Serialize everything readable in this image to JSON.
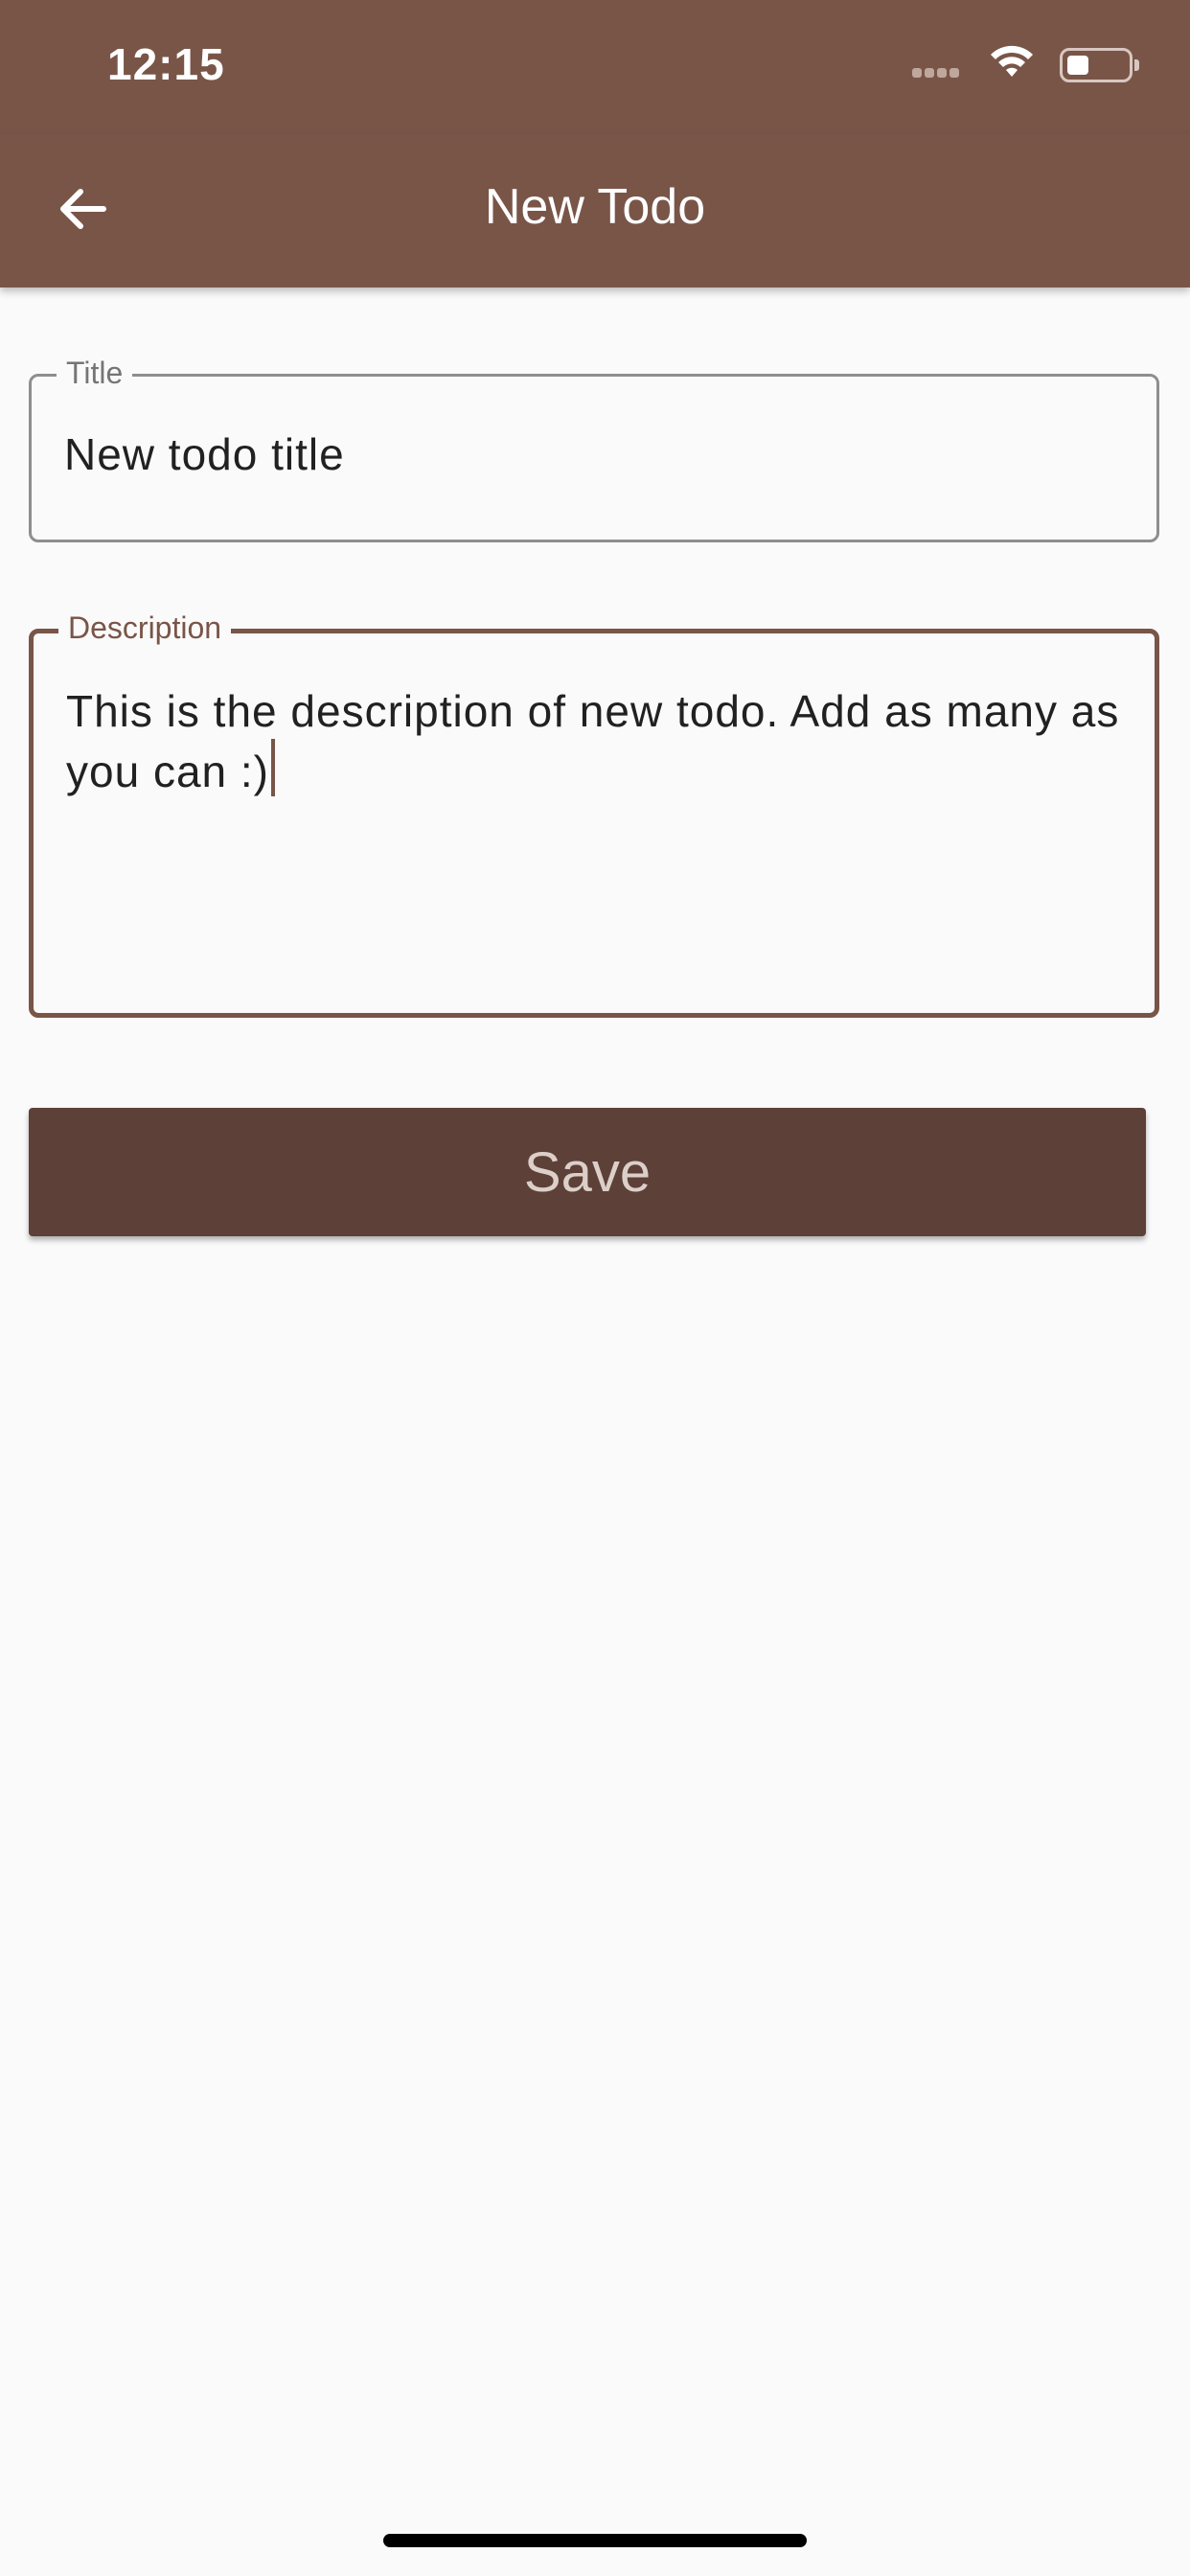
{
  "status_bar": {
    "time": "12:15",
    "icons": [
      "signal-icon",
      "wifi-icon",
      "battery-icon"
    ]
  },
  "app_bar": {
    "title": "New Todo",
    "back_icon": "arrow-left-icon",
    "color": "#795548"
  },
  "form": {
    "title_field": {
      "label": "Title",
      "value": "New todo title"
    },
    "description_field": {
      "label": "Description",
      "value": "This is the description of new todo. Add as many as you can :)",
      "focused": true
    },
    "save_button": {
      "label": "Save",
      "color": "#5d4037"
    }
  }
}
